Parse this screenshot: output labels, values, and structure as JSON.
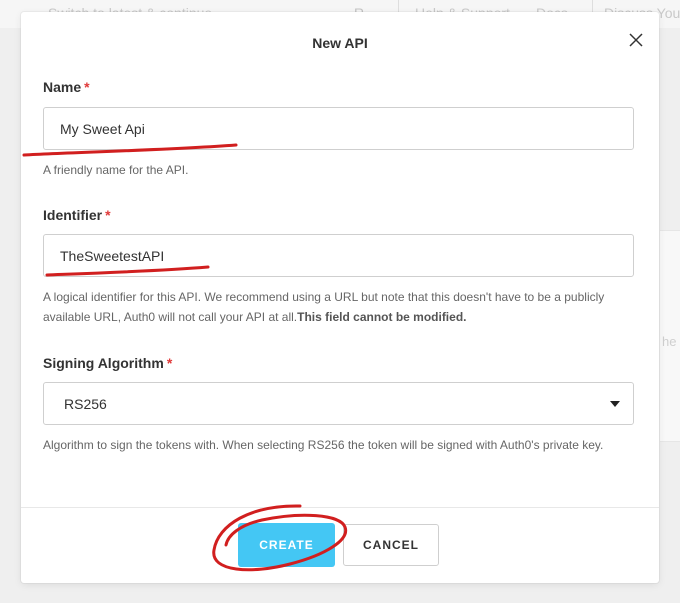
{
  "background_nav": {
    "left_text": "Switch to latest & continue",
    "badge": "R",
    "help_link": "Help & Support",
    "docs_link": "Docs",
    "discuss_link": "Discuss Your"
  },
  "background_side_text": "he",
  "modal": {
    "title": "New API",
    "fields": {
      "name": {
        "label": "Name",
        "required_mark": "*",
        "value": "My Sweet Api",
        "help": "A friendly name for the API."
      },
      "identifier": {
        "label": "Identifier",
        "required_mark": "*",
        "value": "TheSweetestAPI",
        "help": "A logical identifier for this API. We recommend using a URL but note that this doesn't have to be a publicly available URL, Auth0 will not call your API at all.",
        "help_emphasis": "This field cannot be modified."
      },
      "signing_algorithm": {
        "label": "Signing Algorithm",
        "required_mark": "*",
        "value": "RS256",
        "help": "Algorithm to sign the tokens with. When selecting RS256 the token will be signed with Auth0's private key."
      }
    },
    "buttons": {
      "create": "CREATE",
      "cancel": "CANCEL"
    }
  },
  "colors": {
    "accent": "#44c7f4",
    "required": "#e03a3a",
    "annotation": "#d11f1f"
  },
  "icons": {
    "close": "close-icon",
    "dropdown": "chevron-down-icon"
  }
}
